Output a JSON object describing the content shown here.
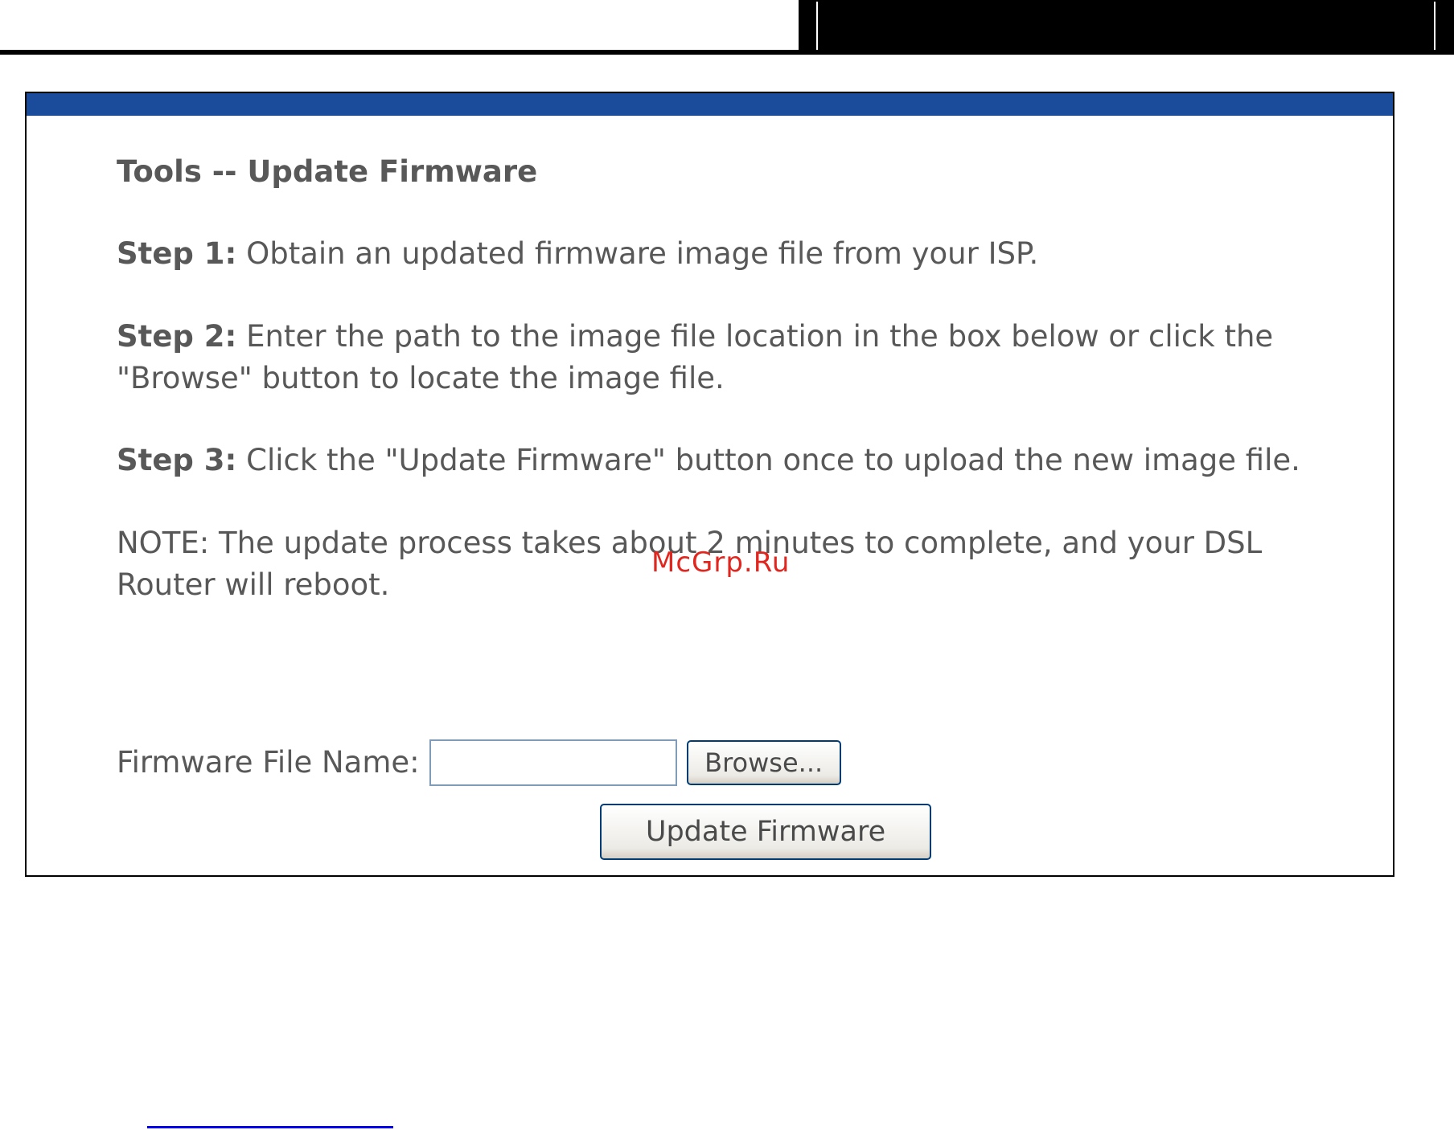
{
  "page": {
    "title": "Tools -- Update Firmware"
  },
  "steps": [
    {
      "label": "Step 1:",
      "text": " Obtain an updated firmware image file from your ISP."
    },
    {
      "label": "Step 2:",
      "text": " Enter the path to the image file location in the box below or click the \"Browse\" button to locate the image file."
    },
    {
      "label": "Step 3:",
      "text": " Click the \"Update Firmware\" button once to upload the new image file."
    }
  ],
  "note": "NOTE: The update process takes about 2 minutes to complete, and your DSL Router will reboot.",
  "form": {
    "file_label": "Firmware File Name:",
    "file_value": "",
    "browse_label": "Browse...",
    "update_label": "Update Firmware"
  },
  "watermark": "McGrp.Ru",
  "colors": {
    "header_bar": "#1b4c9c",
    "text": "#585858",
    "watermark": "#e0261e"
  }
}
